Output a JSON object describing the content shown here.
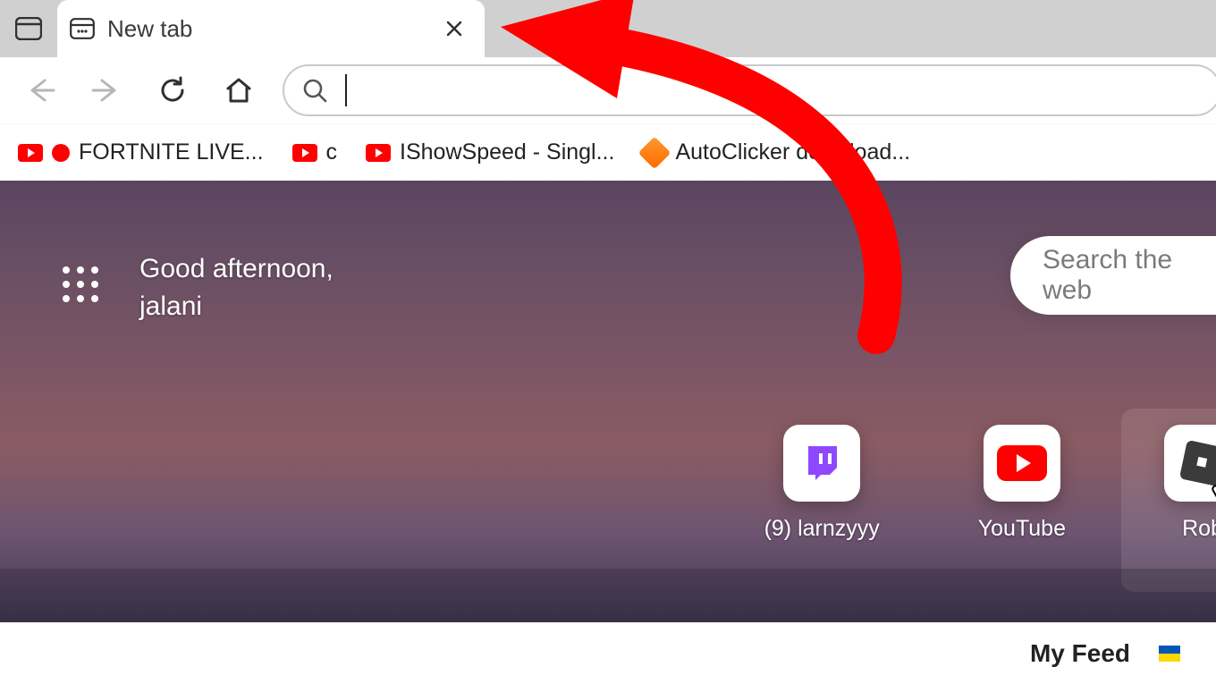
{
  "tab": {
    "title": "New tab"
  },
  "bookmarks": [
    {
      "kind": "youtube_live",
      "label": "FORTNITE LIVE..."
    },
    {
      "kind": "youtube",
      "label": "c"
    },
    {
      "kind": "youtube",
      "label": "IShowSpeed - Singl..."
    },
    {
      "kind": "autoclicker",
      "label": "AutoClicker download..."
    }
  ],
  "greeting": {
    "line1": "Good afternoon,",
    "line2": "jalani"
  },
  "web_search_placeholder": "Search the web",
  "quick_links": [
    {
      "icon": "twitch",
      "label": "(9) larnzyyy"
    },
    {
      "icon": "youtube",
      "label": "YouTube"
    },
    {
      "icon": "roblox",
      "label": "Rob"
    }
  ],
  "feed": {
    "label": "My Feed"
  }
}
